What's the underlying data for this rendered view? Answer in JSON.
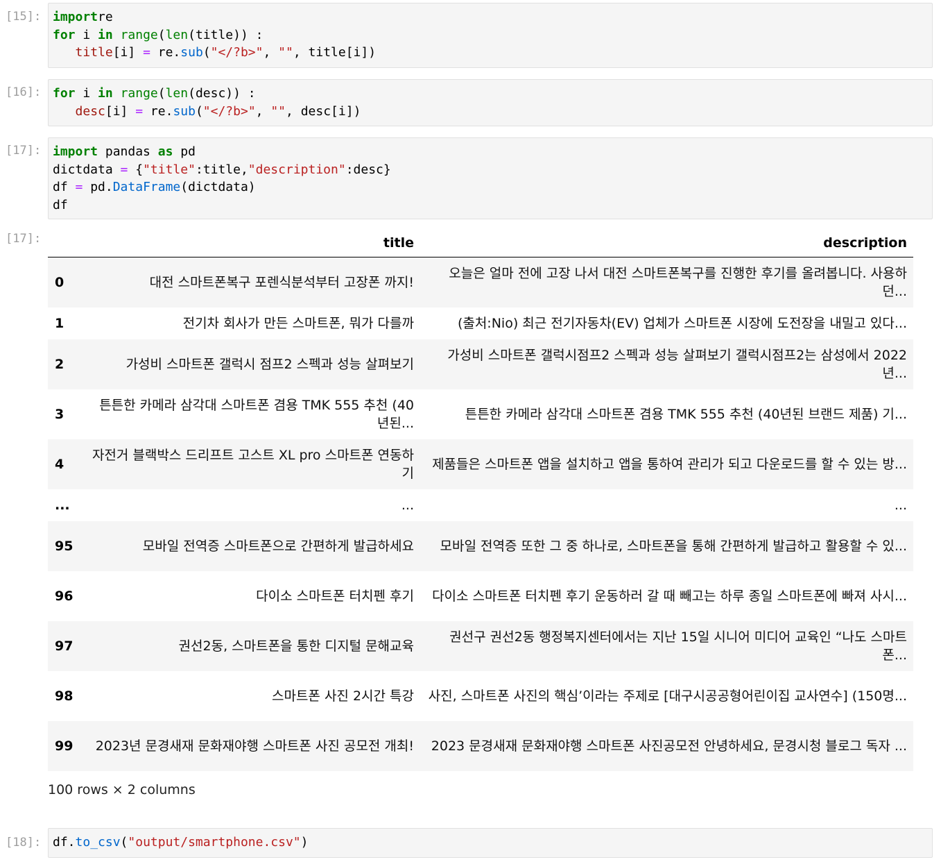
{
  "cells": [
    {
      "prompt": "[15]:",
      "lines": [
        [
          [
            "kw",
            "import"
          ],
          [
            "",
            "re"
          ]
        ],
        [
          [
            "kw",
            "for"
          ],
          [
            "",
            " i "
          ],
          [
            "kw",
            "in"
          ],
          [
            "",
            " "
          ],
          [
            "fn",
            "range"
          ],
          [
            "",
            "("
          ],
          [
            "fn",
            "len"
          ],
          [
            "",
            "(title)) :"
          ]
        ],
        [
          [
            "",
            "   "
          ],
          [
            "var",
            "title"
          ],
          [
            "",
            "[i] "
          ],
          [
            "op",
            "="
          ],
          [
            "",
            " re."
          ],
          [
            "meth",
            "sub"
          ],
          [
            "",
            "("
          ],
          [
            "str",
            "\"</?b>\""
          ],
          [
            "",
            ", "
          ],
          [
            "str",
            "\"\""
          ],
          [
            "",
            ", title[i])"
          ]
        ]
      ]
    },
    {
      "prompt": "[16]:",
      "lines": [
        [
          [
            "kw",
            "for"
          ],
          [
            "",
            " i "
          ],
          [
            "kw",
            "in"
          ],
          [
            "",
            " "
          ],
          [
            "fn",
            "range"
          ],
          [
            "",
            "("
          ],
          [
            "fn",
            "len"
          ],
          [
            "",
            "(desc)) :"
          ]
        ],
        [
          [
            "",
            "   "
          ],
          [
            "var",
            "desc"
          ],
          [
            "",
            "[i] "
          ],
          [
            "op",
            "="
          ],
          [
            "",
            " re."
          ],
          [
            "meth",
            "sub"
          ],
          [
            "",
            "("
          ],
          [
            "str",
            "\"</?b>\""
          ],
          [
            "",
            ", "
          ],
          [
            "str",
            "\"\""
          ],
          [
            "",
            ", desc[i])"
          ]
        ]
      ]
    },
    {
      "prompt": "[17]:",
      "lines": [
        [
          [
            "kw",
            "import"
          ],
          [
            "",
            " pandas "
          ],
          [
            "kw",
            "as"
          ],
          [
            "",
            " pd"
          ]
        ],
        [
          [
            "",
            "dictdata "
          ],
          [
            "op",
            "="
          ],
          [
            "",
            " {"
          ],
          [
            "str",
            "\"title\""
          ],
          [
            "",
            ":title,"
          ],
          [
            "str",
            "\"description\""
          ],
          [
            "",
            ":desc}"
          ]
        ],
        [
          [
            "",
            "df "
          ],
          [
            "op",
            "="
          ],
          [
            "",
            " pd."
          ],
          [
            "meth",
            "DataFrame"
          ],
          [
            "",
            "(dictdata)"
          ]
        ],
        [
          [
            "",
            "df"
          ]
        ]
      ]
    },
    {
      "prompt": "[18]:",
      "lines": [
        [
          [
            "",
            "df."
          ],
          [
            "meth",
            "to_csv"
          ],
          [
            "",
            "("
          ],
          [
            "str",
            "\"output/smartphone.csv\""
          ],
          [
            "",
            ")"
          ]
        ]
      ]
    }
  ],
  "output_prompt": "[17]:",
  "dataframe": {
    "columns": [
      "",
      "title",
      "description"
    ],
    "rows": [
      {
        "index": "0",
        "title": "대전 스마트폰복구 포렌식분석부터 고장폰 까지!",
        "description": "오늘은 얼마 전에 고장 나서 대전 스마트폰복구를 진행한 후기를 올려봅니다. 사용하던..."
      },
      {
        "index": "1",
        "title": "전기차 회사가 만든 스마트폰, 뭐가 다를까",
        "description": "(출처:Nio) 최근 전기자동차(EV) 업체가 스마트폰 시장에 도전장을 내밀고 있다..."
      },
      {
        "index": "2",
        "title": "가성비 스마트폰 갤럭시 점프2 스펙과 성능 살펴보기",
        "description": "가성비 스마트폰 갤럭시점프2 스펙과 성능 살펴보기 갤럭시점프2는 삼성에서 2022년..."
      },
      {
        "index": "3",
        "title": "튼튼한 카메라 삼각대 스마트폰 겸용 TMK 555 추천 (40년된...",
        "description": "튼튼한 카메라 삼각대 스마트폰 겸용 TMK 555 추천 (40년된 브랜드 제품) 기..."
      },
      {
        "index": "4",
        "title": "자전거 블랙박스 드리프트 고스트 XL pro 스마트폰 연동하기",
        "description": "제품들은 스마트폰 앱을 설치하고 앱을 통하여 관리가 되고 다운로드를 할 수 있는 방..."
      },
      {
        "index": "...",
        "title": "...",
        "description": "..."
      },
      {
        "index": "95",
        "title": "모바일 전역증 스마트폰으로 간편하게 발급하세요",
        "description": "모바일 전역증 또한 그 중 하나로, 스마트폰을 통해 간편하게 발급하고 활용할 수 있..."
      },
      {
        "index": "96",
        "title": "다이소 스마트폰 터치펜 후기",
        "description": "다이소 스마트폰 터치펜 후기 운동하러 갈 때 빼고는 하루 종일 스마트폰에 빠져 사시..."
      },
      {
        "index": "97",
        "title": "권선2동, 스마트폰을 통한 디지털 문해교육",
        "description": "권선구 권선2동 행정복지센터에서는 지난 15일 시니어 미디어 교육인 “나도 스마트폰..."
      },
      {
        "index": "98",
        "title": "스마트폰 사진 2시간 특강",
        "description": "사진, 스마트폰 사진의 핵심’이라는 주제로 [대구시공공형어린이집 교사연수] (150명..."
      },
      {
        "index": "99",
        "title": "2023년 문경새재 문화재야행 스마트폰 사진 공모전 개최!",
        "description": "2023 문경새재 문화재야행 스마트폰 사진공모전 안녕하세요, 문경시청 블로그 독자 ..."
      }
    ],
    "shape": "100 rows × 2 columns"
  }
}
